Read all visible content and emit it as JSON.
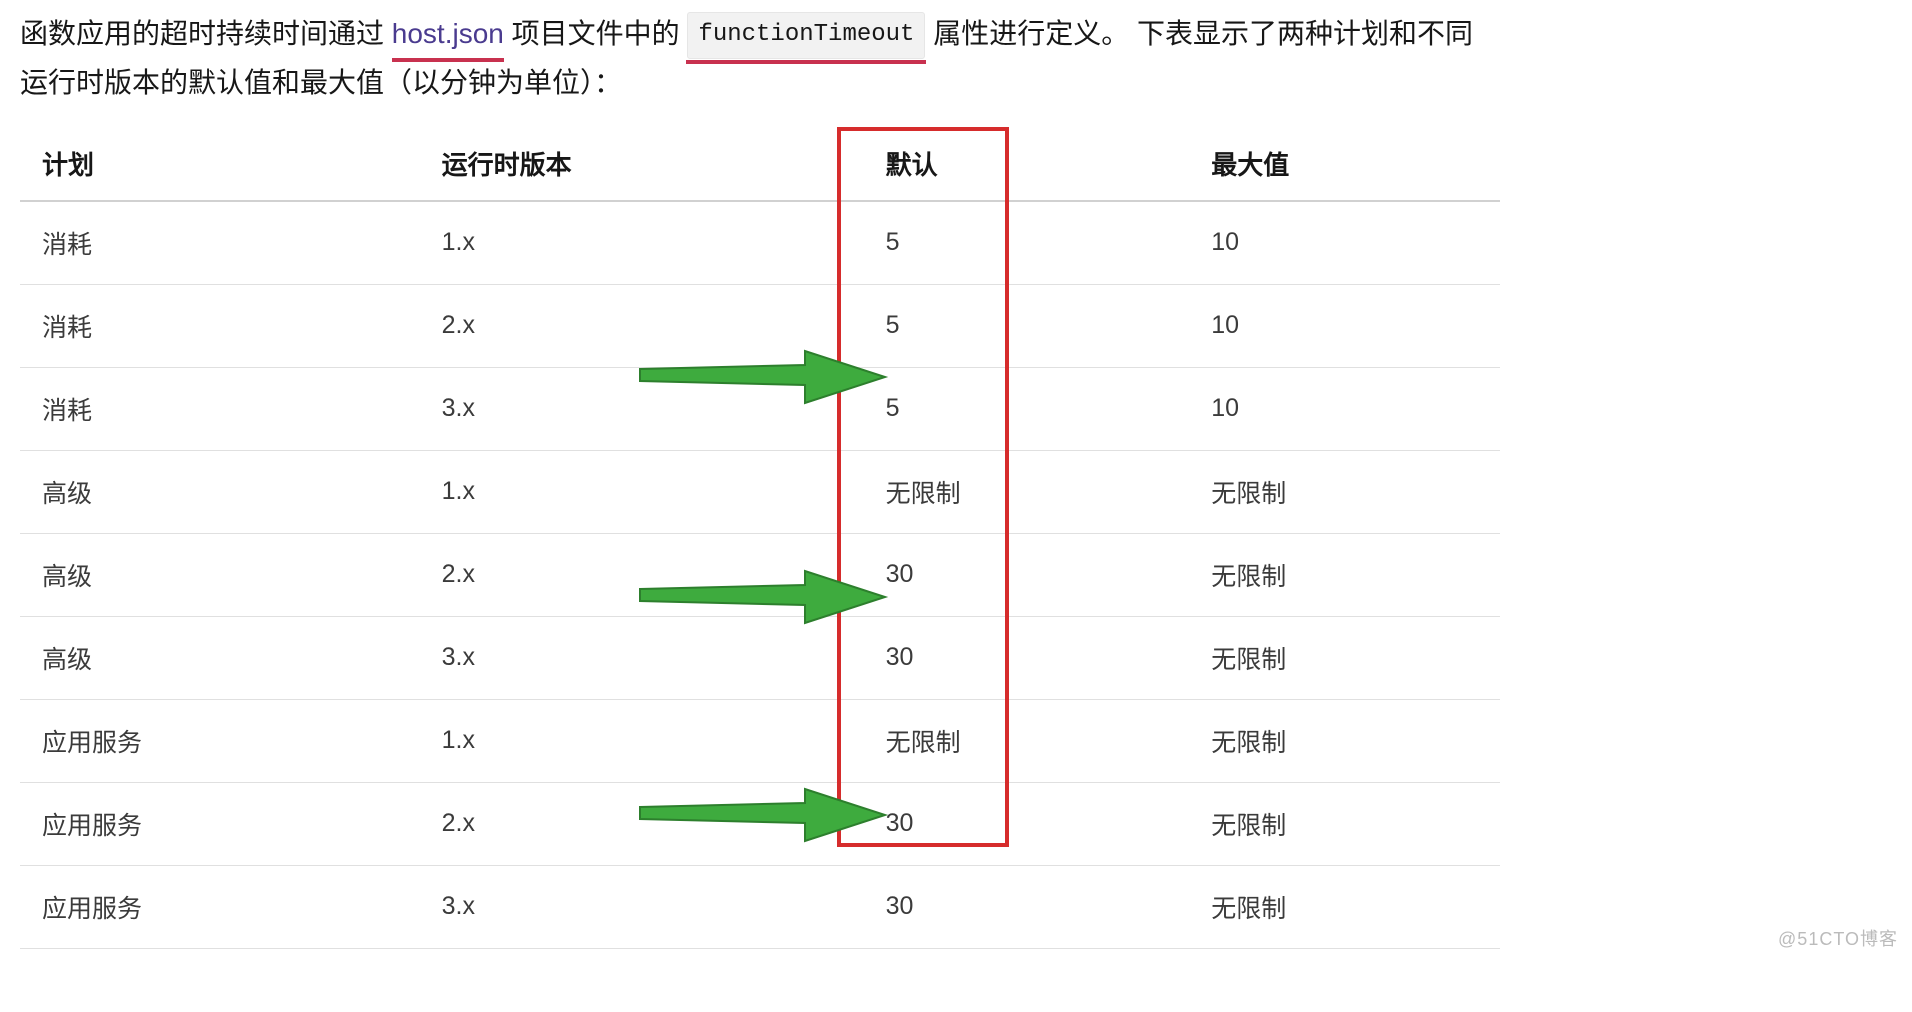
{
  "intro": {
    "prefix": "函数应用的超时持续时间通过 ",
    "link": "host.json",
    "mid1": " 项目文件中的 ",
    "code": "functionTimeout",
    "mid2": " 属性进行定义。 下表显示了两种计划和不同运行时版本的默认值和最大值（以分钟为单位）："
  },
  "table": {
    "headers": {
      "plan": "计划",
      "version": "运行时版本",
      "default": "默认",
      "max": "最大值"
    },
    "rows": [
      {
        "plan": "消耗",
        "version": "1.x",
        "default": "5",
        "max": "10"
      },
      {
        "plan": "消耗",
        "version": "2.x",
        "default": "5",
        "max": "10"
      },
      {
        "plan": "消耗",
        "version": "3.x",
        "default": "5",
        "max": "10"
      },
      {
        "plan": "高级",
        "version": "1.x",
        "default": "无限制",
        "max": "无限制"
      },
      {
        "plan": "高级",
        "version": "2.x",
        "default": "30",
        "max": "无限制"
      },
      {
        "plan": "高级",
        "version": "3.x",
        "default": "30",
        "max": "无限制"
      },
      {
        "plan": "应用服务",
        "version": "1.x",
        "default": "无限制",
        "max": "无限制"
      },
      {
        "plan": "应用服务",
        "version": "2.x",
        "default": "30",
        "max": "无限制"
      },
      {
        "plan": "应用服务",
        "version": "3.x",
        "default": "30",
        "max": "无限制"
      }
    ]
  },
  "watermark": "@51CTO博客",
  "annotations": {
    "highlight_column": "default",
    "arrow_rows": [
      2,
      5,
      8
    ]
  }
}
